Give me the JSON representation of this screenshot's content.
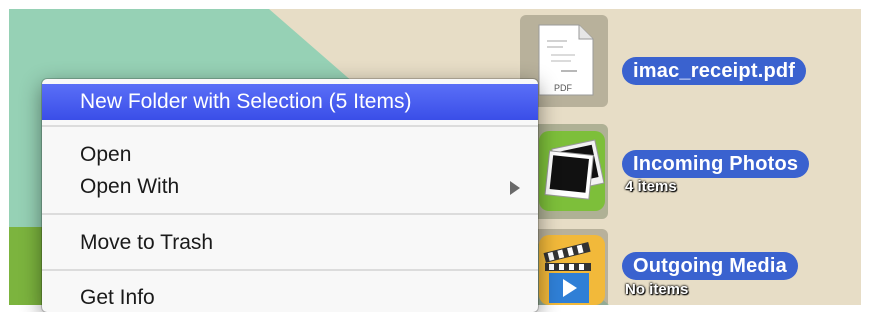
{
  "context_menu": {
    "items": [
      {
        "label": "New Folder with Selection (5 Items)",
        "highlighted": true
      },
      {
        "label": "Open"
      },
      {
        "label": "Open With",
        "submenu": true
      },
      {
        "label": "Move to Trash"
      },
      {
        "label": "Get Info"
      }
    ]
  },
  "files": [
    {
      "name": "imac_receipt.pdf",
      "icon": "pdf-document-icon",
      "thumbnail_text": "PDF"
    },
    {
      "name": "Incoming Photos",
      "subtitle": "4 items",
      "icon": "photos-folder-icon"
    },
    {
      "name": "Outgoing Media",
      "subtitle": "No items",
      "icon": "media-folder-icon"
    }
  ],
  "colors": {
    "selection_label": "#3a62cf",
    "menu_highlight": "#4a5ff0",
    "desktop_green": "#96d1b5",
    "desktop_tan": "#e7ddc6"
  }
}
